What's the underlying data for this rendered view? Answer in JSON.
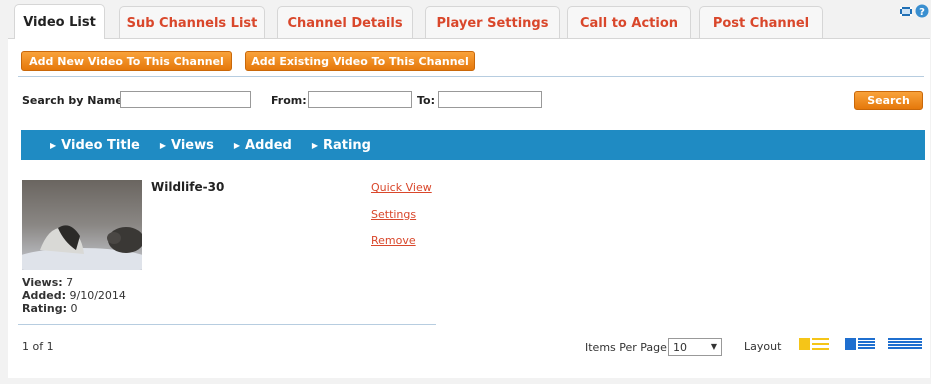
{
  "tabs": [
    {
      "label": "Video List",
      "active": true
    },
    {
      "label": "Sub Channels List"
    },
    {
      "label": "Channel Details"
    },
    {
      "label": "Player Settings"
    },
    {
      "label": "Call to Action"
    },
    {
      "label": "Post Channel"
    }
  ],
  "toolbar": {
    "add_new_label": "Add New Video To This Channel",
    "add_existing_label": "Add Existing Video To This Channel"
  },
  "search": {
    "name_label": "Search by Name:",
    "from_label": "From:",
    "to_label": "To:",
    "name_value": "",
    "from_value": "",
    "to_value": "",
    "button_label": "Search"
  },
  "sort_columns": [
    "Video Title",
    "Views",
    "Added",
    "Rating"
  ],
  "videos": [
    {
      "title": "Wildlife-30",
      "views_label": "Views:",
      "views": "7",
      "added_label": "Added:",
      "added": "9/10/2014",
      "rating_label": "Rating:",
      "rating": "0",
      "actions": [
        "Quick View",
        "Settings",
        "Remove"
      ]
    }
  ],
  "pagination": {
    "page_info": "1 of 1",
    "items_per_page_label": "Items Per Page",
    "items_per_page_value": "10"
  },
  "layout": {
    "label": "Layout"
  },
  "colors": {
    "accent_orange": "#f08a1c",
    "header_blue": "#1f8bc3",
    "link_red": "#d9472b"
  }
}
